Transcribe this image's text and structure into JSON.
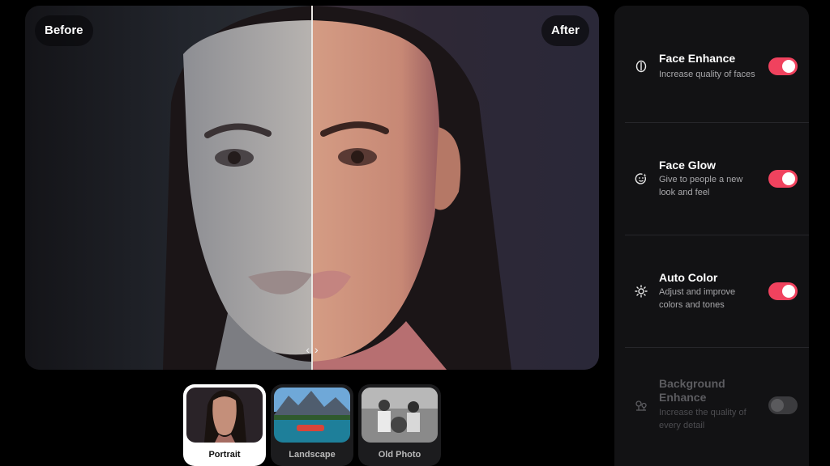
{
  "compare": {
    "before_label": "Before",
    "after_label": "After",
    "handle_left": "‹",
    "handle_right": "›"
  },
  "samples": [
    {
      "label": "Portrait",
      "selected": true
    },
    {
      "label": "Landscape",
      "selected": false
    },
    {
      "label": "Old Photo",
      "selected": false
    }
  ],
  "settings": [
    {
      "title": "Face Enhance",
      "description": "Increase quality of faces",
      "enabled": true,
      "icon": "face-enhance-icon"
    },
    {
      "title": "Face Glow",
      "description": "Give to people a new look and feel",
      "enabled": true,
      "icon": "face-glow-icon"
    },
    {
      "title": "Auto Color",
      "description": "Adjust and improve colors and tones",
      "enabled": true,
      "icon": "sun-icon"
    },
    {
      "title": "Background Enhance",
      "description": "Increase the quality of every detail",
      "enabled": false,
      "icon": "trees-icon"
    }
  ],
  "colors": {
    "accent": "#f0425e",
    "panel_bg": "#121214",
    "page_bg": "#000000"
  }
}
